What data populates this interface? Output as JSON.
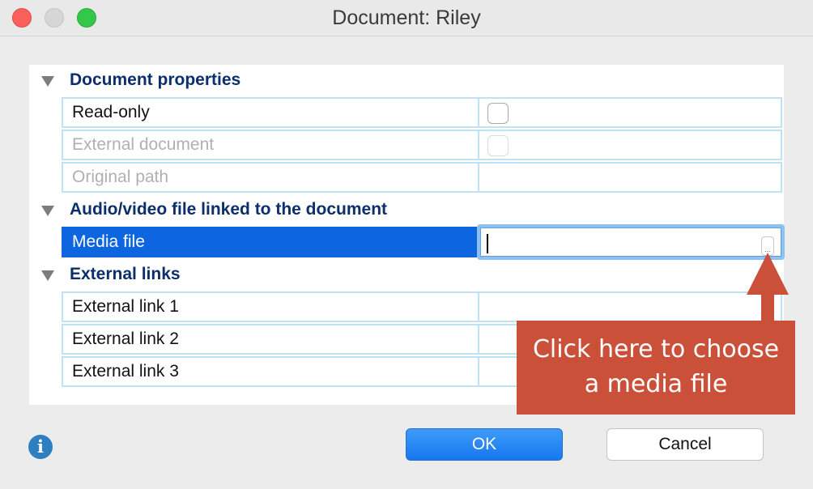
{
  "window": {
    "title": "Document:  Riley"
  },
  "sections": [
    {
      "title": "Document properties",
      "rows": [
        {
          "label": "Read-only",
          "type": "checkbox",
          "enabled": true,
          "checked": false
        },
        {
          "label": "External document",
          "type": "checkbox",
          "enabled": false,
          "checked": false
        },
        {
          "label": "Original path",
          "type": "text",
          "enabled": false,
          "value": ""
        }
      ]
    },
    {
      "title": "Audio/video file linked to the document",
      "rows": [
        {
          "label": "Media file",
          "type": "file",
          "enabled": true,
          "selected": true,
          "value": ""
        }
      ]
    },
    {
      "title": "External links",
      "rows": [
        {
          "label": "External link 1",
          "type": "text",
          "value": ""
        },
        {
          "label": "External link 2",
          "type": "text",
          "value": ""
        },
        {
          "label": "External link 3",
          "type": "text",
          "value": ""
        }
      ]
    }
  ],
  "browse_button": {
    "label": "..."
  },
  "callout": {
    "line1": "Click here to choose",
    "line2": "a media file",
    "color": "#cb5039"
  },
  "footer": {
    "info_icon": "info-icon",
    "info_glyph": "i",
    "ok_label": "OK",
    "cancel_label": "Cancel"
  },
  "colors": {
    "section_title": "#0b2f6b",
    "selection": "#0d66e0",
    "grid": "#bfe3f5",
    "ok_button": "#1677f0"
  }
}
